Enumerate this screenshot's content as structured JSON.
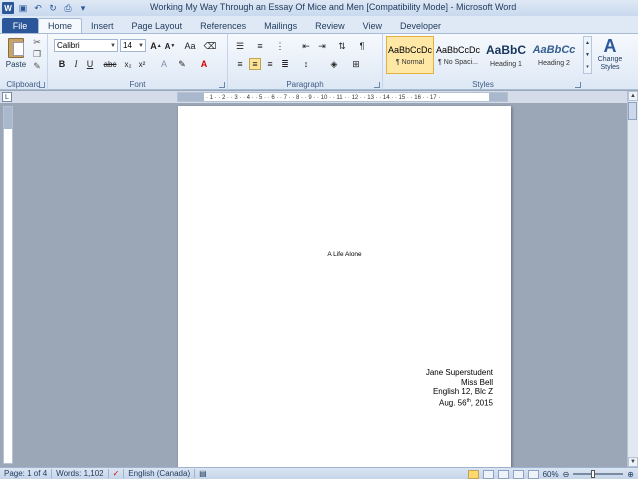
{
  "window": {
    "title": "Working My Way Through an Essay Of Mice and Men [Compatibility Mode] - Microsoft Word"
  },
  "tabs": [
    {
      "label": "File"
    },
    {
      "label": "Home"
    },
    {
      "label": "Insert"
    },
    {
      "label": "Page Layout"
    },
    {
      "label": "References"
    },
    {
      "label": "Mailings"
    },
    {
      "label": "Review"
    },
    {
      "label": "View"
    },
    {
      "label": "Developer"
    }
  ],
  "ribbon": {
    "clipboard": {
      "paste_label": "Paste",
      "group_label": "Clipboard"
    },
    "font": {
      "family": "Calibri",
      "size": "14",
      "group_label": "Font"
    },
    "paragraph": {
      "group_label": "Paragraph"
    },
    "styles": {
      "items": [
        {
          "sample": "AaBbCcDc",
          "name": "¶ Normal"
        },
        {
          "sample": "AaBbCcDc",
          "name": "¶ No Spaci..."
        },
        {
          "sample": "AaBbC",
          "name": "Heading 1"
        },
        {
          "sample": "AaBbCc",
          "name": "Heading 2"
        }
      ],
      "change_label": "Change Styles",
      "group_label": "Styles"
    }
  },
  "document": {
    "title": "A Life Alone",
    "info_lines": [
      "Jane Superstudent",
      "Miss Bell",
      "English 12, Blc Z"
    ],
    "date_prefix": "Aug. 56",
    "date_sup": "th",
    "date_suffix": ", 2015"
  },
  "status": {
    "page": "Page: 1 of 4",
    "words": "Words: 1,102",
    "language": "English (Canada)",
    "zoom": "60%"
  },
  "accent_color": "#2b579a"
}
